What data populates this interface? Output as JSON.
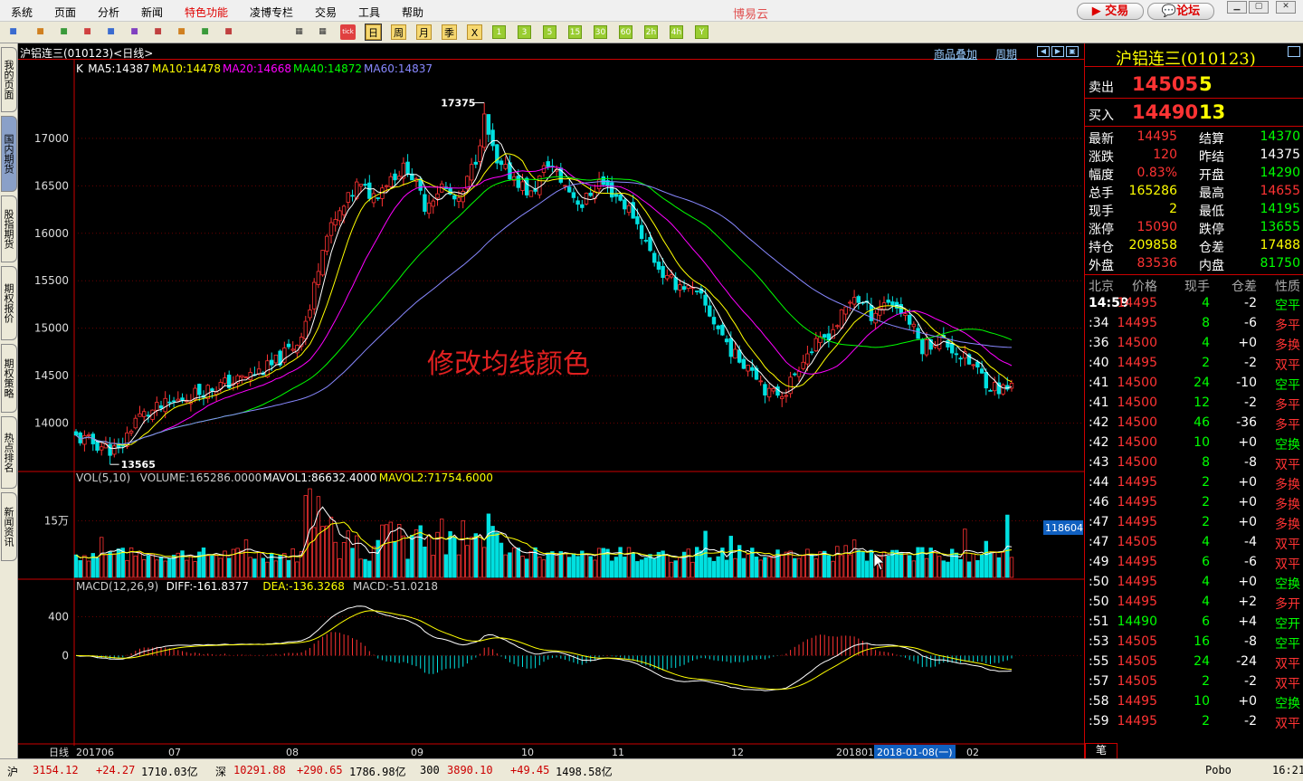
{
  "menu": {
    "items": [
      {
        "label": "系统",
        "x": 12
      },
      {
        "label": "页面",
        "x": 60
      },
      {
        "label": "分析",
        "x": 108
      },
      {
        "label": "新闻",
        "x": 156
      },
      {
        "label": "特色功能",
        "x": 204,
        "hot": true
      },
      {
        "label": "凌博专栏",
        "x": 276
      },
      {
        "label": "交易",
        "x": 348
      },
      {
        "label": "工具",
        "x": 396
      },
      {
        "label": "帮助",
        "x": 444
      }
    ],
    "app_name": "博易云",
    "trade_btn": "交易",
    "forum_btn": "论坛"
  },
  "toolbar": {
    "period_buttons": [
      "日",
      "周",
      "月",
      "季",
      "X",
      "1",
      "3",
      "5",
      "15",
      "30",
      "60",
      "2h",
      "4h",
      "Y"
    ],
    "tick": "tick"
  },
  "sidebar": {
    "tabs": [
      "我的页面",
      "国内期货",
      "股指期货",
      "期权报价",
      "期权策略",
      "热点排名",
      "新闻资讯"
    ]
  },
  "chart_header": {
    "title": "沪铝连三(010123)<日线>",
    "overlay_link": "商品叠加",
    "period_link": "周期"
  },
  "ma_legend": [
    {
      "text": "K",
      "color": "#ffffff"
    },
    {
      "text": "MA5:14387",
      "color": "#ffffff"
    },
    {
      "text": "MA10:14478",
      "color": "#ffff00"
    },
    {
      "text": "MA20:14668",
      "color": "#ff00ff"
    },
    {
      "text": "MA40:14872",
      "color": "#00ff00"
    },
    {
      "text": "MA60:14837",
      "color": "#8888ff"
    }
  ],
  "vol_legend": [
    {
      "text": "VOL(5,10)",
      "color": "#cccccc"
    },
    {
      "text": "VOLUME:165286.0000",
      "color": "#cccccc"
    },
    {
      "text": "MAVOL1:86632.4000",
      "color": "#ffffff"
    },
    {
      "text": "MAVOL2:71754.6000",
      "color": "#ffff00"
    }
  ],
  "macd_legend": [
    {
      "text": "MACD(12,26,9)",
      "color": "#cccccc"
    },
    {
      "text": "DIFF:-161.8377",
      "color": "#ffffff"
    },
    {
      "text": "DEA:-136.3268",
      "color": "#ffff00"
    },
    {
      "text": "MACD:-51.0218",
      "color": "#cccccc"
    }
  ],
  "overlay_text": "修改均线颜色",
  "annotations": {
    "high": "17375",
    "low": "13565",
    "vol_readout": "118604",
    "cursor_date": "2018-01-08(一)"
  },
  "x_axis_labels": [
    "日线",
    "201706",
    "07",
    "08",
    "09",
    "10",
    "11",
    "12",
    "201801",
    "02"
  ],
  "chart_data": [
    {
      "type": "candlestick",
      "title": "沪铝连三(010123)<日线>",
      "ylim": [
        13500,
        17600
      ],
      "yticks": [
        14000,
        14500,
        15000,
        15500,
        16000,
        16500,
        17000
      ],
      "grid": true,
      "series": [
        {
          "name": "MA5",
          "value": 14387,
          "color": "#ffffff"
        },
        {
          "name": "MA10",
          "value": 14478,
          "color": "#ffff00"
        },
        {
          "name": "MA20",
          "value": 14668,
          "color": "#ff00ff"
        },
        {
          "name": "MA40",
          "value": 14872,
          "color": "#00ff00"
        },
        {
          "name": "MA60",
          "value": 14837,
          "color": "#8888ff"
        }
      ],
      "anchors": [
        [
          0,
          13850
        ],
        [
          10,
          13700
        ],
        [
          14,
          14050
        ],
        [
          22,
          14200
        ],
        [
          30,
          14350
        ],
        [
          38,
          14450
        ],
        [
          46,
          14600
        ],
        [
          52,
          14850
        ],
        [
          55,
          15200
        ],
        [
          58,
          15900
        ],
        [
          62,
          16200
        ],
        [
          66,
          16500
        ],
        [
          70,
          16400
        ],
        [
          74,
          16600
        ],
        [
          78,
          16700
        ],
        [
          82,
          16300
        ],
        [
          86,
          16500
        ],
        [
          90,
          16300
        ],
        [
          94,
          16800
        ],
        [
          96,
          17200
        ],
        [
          99,
          16700
        ],
        [
          103,
          16600
        ],
        [
          107,
          16400
        ],
        [
          111,
          16750
        ],
        [
          115,
          16500
        ],
        [
          119,
          16300
        ],
        [
          123,
          16550
        ],
        [
          127,
          16400
        ],
        [
          131,
          16200
        ],
        [
          135,
          15800
        ],
        [
          139,
          15500
        ],
        [
          143,
          15450
        ],
        [
          147,
          15300
        ],
        [
          151,
          15000
        ],
        [
          155,
          14700
        ],
        [
          159,
          14600
        ],
        [
          163,
          14300
        ],
        [
          167,
          14350
        ],
        [
          171,
          14700
        ],
        [
          175,
          14850
        ],
        [
          179,
          15050
        ],
        [
          183,
          15350
        ],
        [
          187,
          15150
        ],
        [
          191,
          15300
        ],
        [
          195,
          15150
        ],
        [
          199,
          14800
        ],
        [
          203,
          14900
        ],
        [
          207,
          14750
        ],
        [
          211,
          14600
        ],
        [
          215,
          14400
        ],
        [
          218,
          14350
        ],
        [
          220,
          14390
        ]
      ]
    },
    {
      "type": "bar",
      "title": "VOL(5,10)",
      "yticks": [
        {
          "value": 150000,
          "label": "15万"
        }
      ],
      "seed": 7
    },
    {
      "type": "bar",
      "title": "MACD(12,26,9)",
      "ylim": [
        -900,
        600
      ],
      "yticks": [
        400,
        0
      ],
      "diff": -161.8377,
      "dea": -136.3268,
      "macd": -51.0218
    }
  ],
  "quote": {
    "title": "沪铝连三(010123)",
    "ask_label": "卖出",
    "ask_price": "14505",
    "ask_vol": "5",
    "bid_label": "买入",
    "bid_price": "14490",
    "bid_vol": "13",
    "rows": [
      [
        "最新",
        "14495",
        "#ff3333",
        "结算",
        "14370",
        "#00ff00"
      ],
      [
        "涨跌",
        "120",
        "#ff3333",
        "昨结",
        "14375",
        "#ffffff"
      ],
      [
        "幅度",
        "0.83%",
        "#ff3333",
        "开盘",
        "14290",
        "#00ff00"
      ],
      [
        "总手",
        "165286",
        "#ffff00",
        "最高",
        "14655",
        "#ff3333"
      ],
      [
        "现手",
        "2",
        "#ffff00",
        "最低",
        "14195",
        "#00ff00"
      ],
      [
        "涨停",
        "15090",
        "#ff3333",
        "跌停",
        "13655",
        "#00ff00"
      ],
      [
        "持仓",
        "209858",
        "#ffff00",
        "仓差",
        "17488",
        "#ffff00"
      ],
      [
        "外盘",
        "83536",
        "#ff3333",
        "内盘",
        "81750",
        "#00ff00"
      ]
    ],
    "tick_header": [
      "北京",
      "价格",
      "现手",
      "仓差",
      "性质"
    ],
    "ticks": [
      [
        "14:59",
        "14495",
        "4",
        "-2",
        "空平"
      ],
      [
        ":34",
        "14495",
        "8",
        "-6",
        "多平"
      ],
      [
        ":36",
        "14500",
        "4",
        "+0",
        "多换"
      ],
      [
        ":40",
        "14495",
        "2",
        "-2",
        "双平"
      ],
      [
        ":41",
        "14500",
        "24",
        "-10",
        "空平"
      ],
      [
        ":41",
        "14500",
        "12",
        "-2",
        "多平"
      ],
      [
        ":42",
        "14500",
        "46",
        "-36",
        "多平"
      ],
      [
        ":42",
        "14500",
        "10",
        "+0",
        "空换"
      ],
      [
        ":43",
        "14500",
        "8",
        "-8",
        "双平"
      ],
      [
        ":44",
        "14495",
        "2",
        "+0",
        "多换"
      ],
      [
        ":46",
        "14495",
        "2",
        "+0",
        "多换"
      ],
      [
        ":47",
        "14495",
        "2",
        "+0",
        "多换"
      ],
      [
        ":47",
        "14505",
        "4",
        "-4",
        "双平"
      ],
      [
        ":49",
        "14495",
        "6",
        "-6",
        "双平"
      ],
      [
        ":50",
        "14495",
        "4",
        "+0",
        "空换"
      ],
      [
        ":50",
        "14495",
        "4",
        "+2",
        "多开"
      ],
      [
        ":51",
        "14490",
        "6",
        "+4",
        "空开"
      ],
      [
        ":53",
        "14505",
        "16",
        "-8",
        "空平"
      ],
      [
        ":55",
        "14505",
        "24",
        "-24",
        "双平"
      ],
      [
        ":57",
        "14505",
        "2",
        "-2",
        "双平"
      ],
      [
        ":58",
        "14495",
        "10",
        "+0",
        "空换"
      ],
      [
        ":59",
        "14495",
        "2",
        "-2",
        "双平"
      ]
    ],
    "bottom_tab": "笔"
  },
  "status": [
    {
      "t": "沪",
      "c": "#000",
      "x": 8
    },
    {
      "t": "3154.12",
      "c": "#c00",
      "x": 36
    },
    {
      "t": "+24.27",
      "c": "#c00",
      "x": 106
    },
    {
      "t": "1710.03亿",
      "c": "#000",
      "x": 156
    },
    {
      "t": "深",
      "c": "#000",
      "x": 238
    },
    {
      "t": "10291.88",
      "c": "#c00",
      "x": 258
    },
    {
      "t": "+290.65",
      "c": "#c00",
      "x": 328
    },
    {
      "t": "1786.98亿",
      "c": "#000",
      "x": 386
    },
    {
      "t": "300",
      "c": "#000",
      "x": 464
    },
    {
      "t": "3890.10",
      "c": "#c00",
      "x": 494
    },
    {
      "t": "+49.45",
      "c": "#c00",
      "x": 564
    },
    {
      "t": "1498.58亿",
      "c": "#000",
      "x": 614
    },
    {
      "t": "Pobo",
      "c": "#000",
      "x": 1332
    },
    {
      "t": "16:21",
      "c": "#000",
      "x": 1406
    }
  ]
}
